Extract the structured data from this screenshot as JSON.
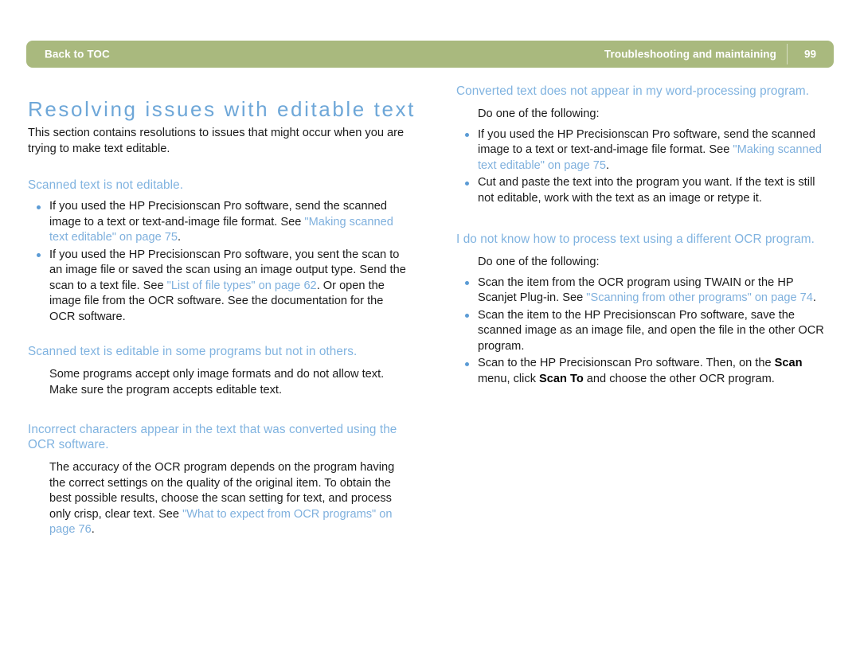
{
  "header": {
    "back_label": "Back to TOC",
    "section_label": "Troubleshooting and maintaining",
    "page_number": "99",
    "bar_color": "#a9b97e",
    "text_color": "#ffffff"
  },
  "page": {
    "title": "Resolving issues with editable text",
    "title_color": "#6ea7d8",
    "heading_color": "#80b3e0",
    "link_color": "#7fb0dd",
    "bullet_color": "#5b9bd5",
    "intro": "This section contains resolutions to issues that might occur when you are trying to make text editable."
  },
  "left_column": {
    "sections": [
      {
        "heading": "Scanned text is not editable.",
        "bullets": [
          {
            "pre": "If you used the HP Precisionscan Pro software, send the scanned image to a text or text-and-image file format. See ",
            "link": "\"Making scanned text editable\" on page 75",
            "post": "."
          },
          {
            "pre": "If you used the HP Precisionscan Pro software, you sent the scan to an image file or saved the scan using an image output type. Send the scan to a text file. See ",
            "link": "\"List of file types\" on page 62",
            "post": ". Or open the image file from the OCR software. See the documentation for the OCR software."
          }
        ]
      },
      {
        "heading": "Scanned text is editable in some programs but not in others.",
        "paragraph": "Some programs accept only image formats and do not allow text. Make sure the program accepts editable text."
      },
      {
        "heading": "Incorrect characters appear in the text that was converted using the OCR software.",
        "paragraph_pre": "The accuracy of the OCR program depends on the program having the correct settings on the quality of the original item. To obtain the best possible results, choose the scan setting for text, and process only crisp, clear text. See ",
        "paragraph_link": "\"What to expect from OCR programs\" on page 76",
        "paragraph_post": "."
      }
    ]
  },
  "right_column": {
    "sections": [
      {
        "heading": "Converted text does not appear in my word-processing program.",
        "lead_in": "Do one of the following:",
        "bullets": [
          {
            "pre": "If you used the HP Precisionscan Pro software, send the scanned image to a text or text-and-image file format. See ",
            "link": "\"Making scanned text editable\" on page 75",
            "post": "."
          },
          {
            "pre": "Cut and paste the text into the program you want. If the text is still not editable, work with the text as an image or retype it.",
            "link": "",
            "post": ""
          }
        ]
      },
      {
        "heading": "I do not know how to process text using a different OCR program.",
        "lead_in": "Do one of the following:",
        "bullets": [
          {
            "pre": "Scan the item from the OCR program using TWAIN or the HP Scanjet Plug-in. See ",
            "link": "\"Scanning from other programs\" on page 74",
            "post": "."
          },
          {
            "pre": "Scan the item to the HP Precisionscan Pro software, save the scanned image as an image file, and open the file in the other OCR program.",
            "link": "",
            "post": ""
          },
          {
            "pre_a": "Scan to the HP Precisionscan Pro software. Then, on the ",
            "bold_a": "Scan",
            "mid": " menu, click ",
            "bold_b": "Scan To",
            "post_b": " and choose the other OCR program."
          }
        ]
      }
    ]
  }
}
